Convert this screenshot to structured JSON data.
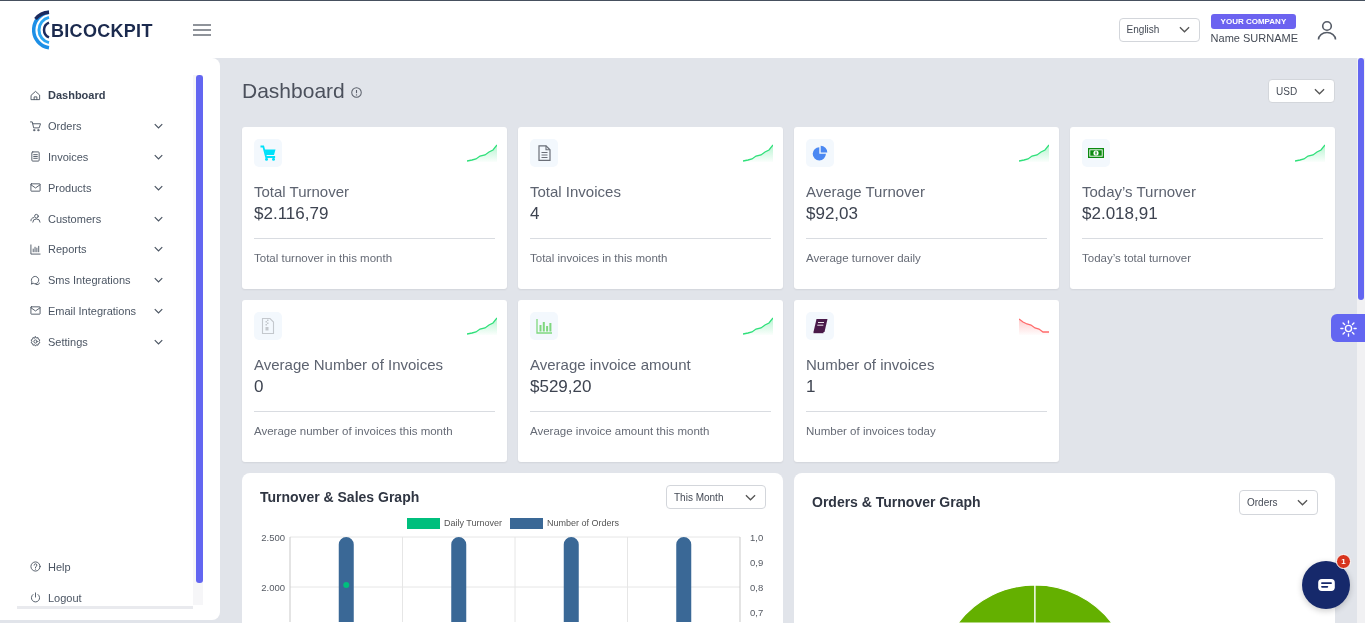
{
  "header": {
    "logo_text": "BICOCKPIT",
    "language_select": "English",
    "company_badge": "YOUR COMPANY",
    "user_name": "Name SURNAME"
  },
  "sidebar": {
    "items": [
      {
        "label": "Dashboard",
        "selected": true,
        "expandable": false
      },
      {
        "label": "Orders",
        "selected": false,
        "expandable": true
      },
      {
        "label": "Invoices",
        "selected": false,
        "expandable": true
      },
      {
        "label": "Products",
        "selected": false,
        "expandable": true
      },
      {
        "label": "Customers",
        "selected": false,
        "expandable": true
      },
      {
        "label": "Reports",
        "selected": false,
        "expandable": true
      },
      {
        "label": "Sms Integrations",
        "selected": false,
        "expandable": true
      },
      {
        "label": "Email Integrations",
        "selected": false,
        "expandable": true
      },
      {
        "label": "Settings",
        "selected": false,
        "expandable": true
      }
    ],
    "footer_items": [
      {
        "label": "Help"
      },
      {
        "label": "Logout"
      }
    ]
  },
  "page": {
    "title": "Dashboard",
    "currency_select": "USD"
  },
  "stat_cards": [
    {
      "title": "Total Turnover",
      "value": "$2.116,79",
      "caption": "Total turnover in this month",
      "rising": true
    },
    {
      "title": "Total Invoices",
      "value": "4",
      "caption": "Total invoices in this month",
      "rising": true
    },
    {
      "title": "Average Turnover",
      "value": "$92,03",
      "caption": "Average turnover daily",
      "rising": true
    },
    {
      "title": "Today’s Turnover",
      "value": "$2.018,91",
      "caption": "Today’s total turnover",
      "rising": true
    },
    {
      "title": "Average Number of Invoices",
      "value": "0",
      "caption": "Average number of invoices this month",
      "rising": true
    },
    {
      "title": "Average invoice amount",
      "value": "$529,20",
      "caption": "Average invoice amount this month",
      "rising": true
    },
    {
      "title": "Number of invoices",
      "value": "1",
      "caption": "Number of invoices today",
      "rising": false
    }
  ],
  "charts": [
    {
      "period_select": "This Month",
      "chart_data": {
        "type": "bar",
        "title": "Turnover & Sales Graph",
        "legend": "top",
        "series": [
          {
            "name": "Daily Turnover",
            "color": "#00bf7d",
            "type": "line",
            "marker": "circle",
            "values": [
              2020,
              null,
              null,
              null
            ]
          },
          {
            "name": "Number of Orders",
            "color": "#3a6896",
            "type": "bar",
            "axis": "y2",
            "values": [
              1,
              1,
              1,
              1
            ]
          }
        ],
        "ylim": [
          1650,
          2500
        ],
        "yticks": [
          {
            "value": 2000,
            "label": "2.000"
          },
          {
            "value": 2500,
            "label": "2.500"
          }
        ],
        "y2lim": [
          0.66,
          1
        ],
        "y2ticks": [
          {
            "value": 0.7,
            "label": "0,7"
          },
          {
            "value": 0.8,
            "label": "0,8"
          },
          {
            "value": 0.9,
            "label": "0,9"
          },
          {
            "value": 1,
            "label": "1,0"
          }
        ]
      }
    },
    {
      "title": "Orders & Turnover Graph",
      "period_select": "Orders"
    }
  ],
  "chat_widget": {
    "badge": "1"
  }
}
